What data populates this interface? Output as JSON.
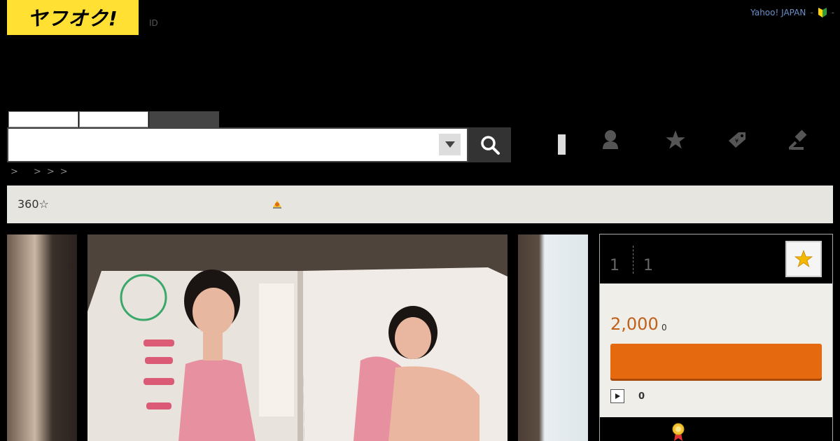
{
  "header": {
    "logo_text": "ヤフオク!",
    "id_link": "ID",
    "yahoo_link": "Yahoo! JAPAN",
    "separator": "-",
    "separator2": "-"
  },
  "search": {
    "placeholder": ""
  },
  "breadcrumb": [
    ">",
    ">",
    ">",
    ">"
  ],
  "seller": {
    "rating": "360☆"
  },
  "bid_panel": {
    "count_a": "1",
    "count_b": "1",
    "price": "2,000",
    "price_suffix": "0",
    "bid_label": "",
    "play_count": "0"
  },
  "colors": {
    "logo_bg": "#ffe033",
    "accent": "#e56a0f",
    "price": "#c0601a",
    "link": "#6b8fc9"
  },
  "icons": [
    "beginner-mark-icon",
    "search-icon",
    "chevron-down-icon",
    "user-icon",
    "star-icon",
    "tag-icon",
    "gavel-icon",
    "badge-icon",
    "play-icon",
    "medal-icon"
  ]
}
